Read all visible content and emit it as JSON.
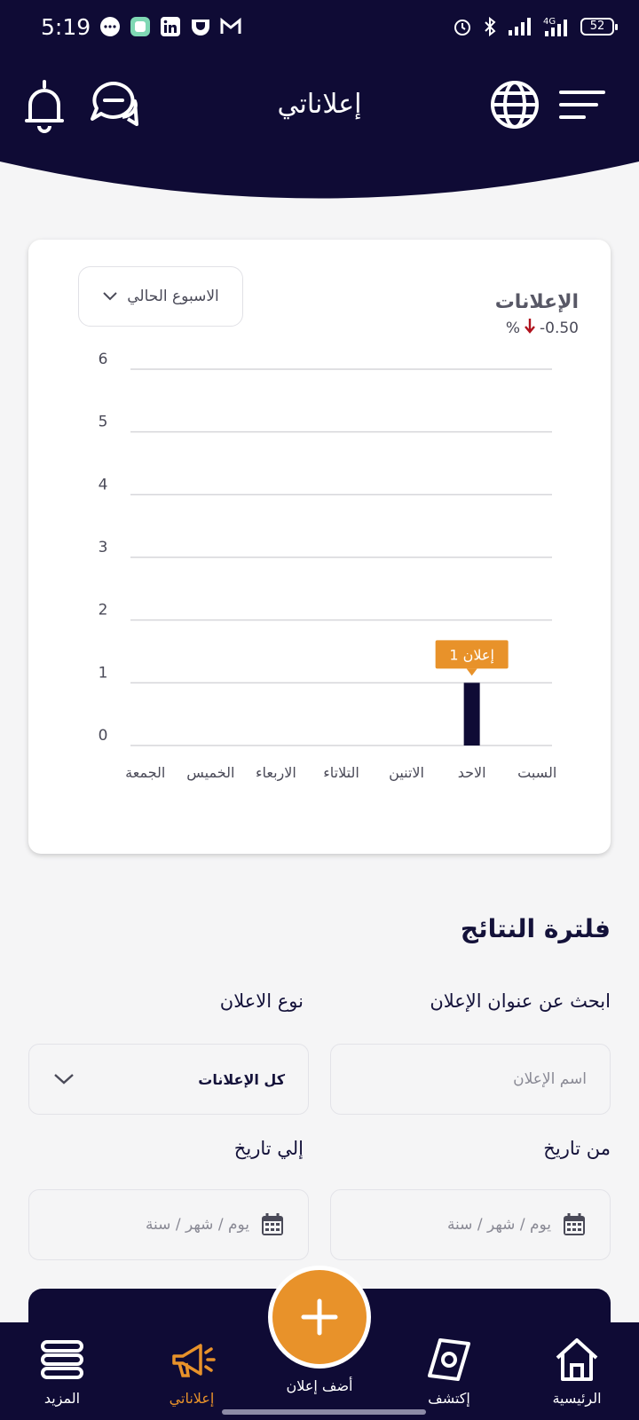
{
  "status_bar": {
    "time": "5:19",
    "battery": "52",
    "network": "4G"
  },
  "header": {
    "title": "إعلاناتي"
  },
  "chart_card": {
    "period_select": "الاسبوع الحالي",
    "title": "الإعلانات",
    "change_value": "-0.50",
    "change_unit": "%",
    "tooltip": "1 إعلان"
  },
  "chart_data": {
    "type": "bar",
    "title": "الإعلانات",
    "categories": [
      "السبت",
      "الاحد",
      "الاتنين",
      "التلاتاء",
      "الاربعاء",
      "الخميس",
      "الجمعة"
    ],
    "values": [
      0,
      1,
      0,
      0,
      0,
      0,
      0
    ],
    "ylim": [
      0,
      6
    ],
    "yticks": [
      "0",
      "1",
      "2",
      "3",
      "4",
      "5",
      "6"
    ],
    "grid": true,
    "bar_color": "#0f0b35"
  },
  "filter": {
    "section_title": "فلترة النتائج",
    "search_label": "ابحث عن عنوان الإعلان",
    "search_placeholder": "اسم الإعلان",
    "type_label": "نوع الاعلان",
    "type_value": "كل الإعلانات",
    "from_label": "من تاريخ",
    "from_placeholder": "يوم / شهر / سنة",
    "to_label": "إلي تاريخ",
    "to_placeholder": "يوم / شهر / سنة"
  },
  "bottom_nav": {
    "items": [
      {
        "label": "الرئيسية",
        "icon": "home-icon"
      },
      {
        "label": "إكتشف",
        "icon": "compass-icon"
      },
      {
        "label": "أضف إعلان",
        "icon": "plus-icon"
      },
      {
        "label": "إعلاناتي",
        "icon": "megaphone-icon"
      },
      {
        "label": "المزيد",
        "icon": "menu-icon"
      }
    ]
  },
  "colors": {
    "primary": "#0f0b35",
    "accent": "#e8922a",
    "negative": "#b0121d"
  }
}
